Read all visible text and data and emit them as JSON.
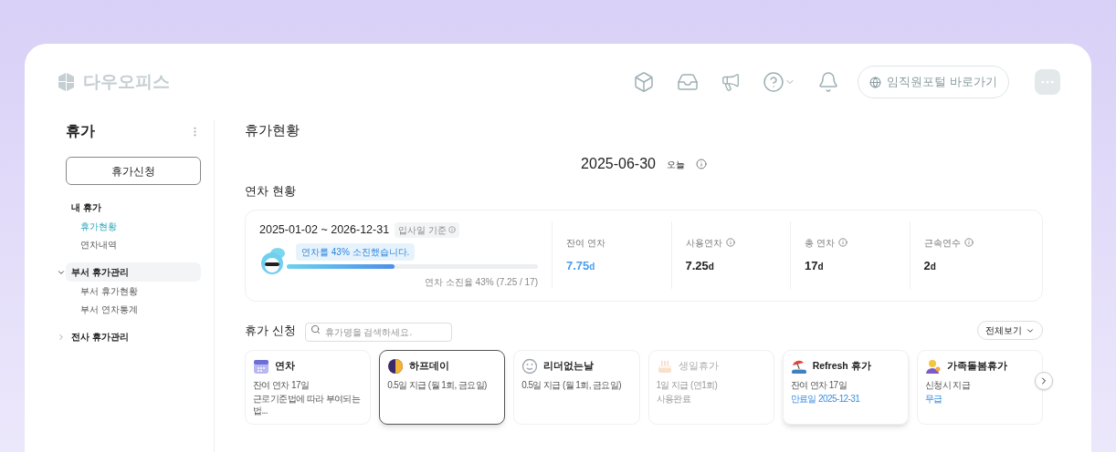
{
  "header": {
    "logo": "다우오피스",
    "portal_button": "임직원포털 바로가기"
  },
  "sidebar": {
    "title": "휴가",
    "apply_button": "휴가신청",
    "groups": [
      {
        "label": "내 휴가",
        "kind": "heading",
        "children": [
          {
            "label": "휴가현황",
            "selected": true
          },
          {
            "label": "연차내역",
            "selected": false
          }
        ]
      },
      {
        "label": "부서 휴가관리",
        "kind": "folder",
        "expanded": true,
        "children": [
          {
            "label": "부서 휴가현황",
            "selected": false
          },
          {
            "label": "부서 연차통계",
            "selected": false
          }
        ]
      },
      {
        "label": "전사 휴가관리",
        "kind": "folder",
        "expanded": false
      }
    ]
  },
  "page_title": "휴가현황",
  "date": {
    "value": "2025-06-30",
    "badge": "오늘"
  },
  "annual": {
    "title": "연차 현황",
    "period": "2025-01-02 ~ 2026-12-31",
    "basis": "입사일 기준",
    "bubble": "연차를 43% 소진했습니다.",
    "level": 0.43,
    "usage_text": "연차 소진율 43% (7.25 / 17)",
    "stats": [
      {
        "label": "잔여 연차",
        "value": "7.75",
        "unit": "d",
        "info": false,
        "kind": "highlight"
      },
      {
        "label": "사용연차",
        "value": "7.25",
        "unit": "d",
        "info": true,
        "kind": "plain"
      },
      {
        "label": "총 연차",
        "value": "17",
        "unit": "d",
        "info": true,
        "kind": "plain"
      },
      {
        "label": "근속연수",
        "value": "2",
        "unit": "d",
        "info": true,
        "kind": "plain"
      }
    ]
  },
  "apply": {
    "title": "휴가 신청",
    "search_placeholder": "휴가명을 검색하세요.",
    "view_all": "전체보기",
    "cards": [
      {
        "name": "연차",
        "selected": false,
        "disabled": false,
        "raised": false,
        "lines": [
          {
            "text": "잔여 연차 17일",
            "kind": "plain"
          },
          {
            "text": "근로기준법에 따라 부여되는 법...",
            "kind": "plain"
          }
        ]
      },
      {
        "name": "하프데이",
        "selected": true,
        "disabled": false,
        "raised": false,
        "lines": [
          {
            "text": "0.5일 지급 (월 1회, 금요일)",
            "kind": "plain"
          }
        ]
      },
      {
        "name": "리더없는날",
        "selected": false,
        "disabled": false,
        "raised": false,
        "lines": [
          {
            "text": "0.5일 지급 (월 1회, 금요일)",
            "kind": "plain"
          }
        ]
      },
      {
        "name": "생일휴가",
        "selected": false,
        "disabled": true,
        "raised": false,
        "lines": [
          {
            "text": "1일 지급 (연1회)",
            "kind": "plain"
          },
          {
            "text": "사용완료",
            "kind": "plain"
          }
        ]
      },
      {
        "name": "Refresh 휴가",
        "selected": false,
        "disabled": false,
        "raised": true,
        "lines": [
          {
            "text": "잔여 연차 17일",
            "kind": "plain"
          },
          {
            "text": "만료일 2025-12-31",
            "kind": "link"
          }
        ]
      },
      {
        "name": "가족돌봄휴가",
        "selected": false,
        "disabled": false,
        "raised": false,
        "lines": [
          {
            "text": "신청시 지급",
            "kind": "plain"
          },
          {
            "text": "무급",
            "kind": "link"
          }
        ]
      }
    ]
  }
}
